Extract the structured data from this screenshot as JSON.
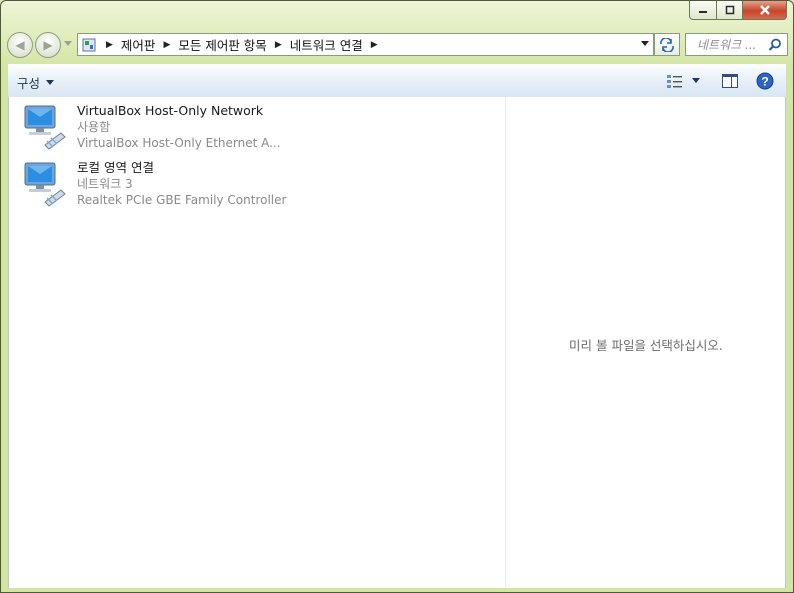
{
  "breadcrumb": [
    "제어판",
    "모든 제어판 항목",
    "네트워크 연결"
  ],
  "search": {
    "placeholder": "네트워크 ..."
  },
  "toolbar": {
    "organize_label": "구성"
  },
  "connections": [
    {
      "name": "VirtualBox Host-Only Network",
      "status": "사용함",
      "device": "VirtualBox Host-Only Ethernet A..."
    },
    {
      "name": "로컬 영역 연결",
      "status": "네트워크  3",
      "device": "Realtek PCIe GBE Family Controller"
    }
  ],
  "preview": {
    "message": "미리 볼 파일을 선택하십시오."
  },
  "colors": {
    "accent": "#1e5fae",
    "frame": "#d3e4a4",
    "toolbar": "#e5eef8"
  }
}
